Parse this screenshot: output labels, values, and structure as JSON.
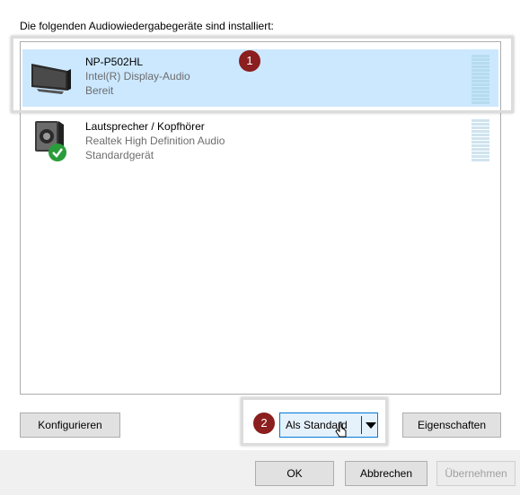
{
  "intro_text": "Die folgenden Audiowiedergabegeräte sind installiert:",
  "devices": [
    {
      "name": "NP-P502HL",
      "driver": "Intel(R) Display-Audio",
      "status": "Bereit",
      "icon": "monitor-icon",
      "selected": true
    },
    {
      "name": "Lautsprecher / Kopfhörer",
      "driver": "Realtek High Definition Audio",
      "status": "Standardgerät",
      "icon": "speaker-icon",
      "default": true
    }
  ],
  "badges": [
    "1",
    "2"
  ],
  "buttons": {
    "configure": "Konfigurieren",
    "set_default": "Als Standard",
    "properties": "Eigenschaften",
    "ok": "OK",
    "cancel": "Abbrechen",
    "apply": "Übernehmen"
  },
  "colors": {
    "selection": "#cce8ff",
    "badge": "#8b1e1e",
    "focus_border": "#0078d7",
    "check_green": "#2a9d3a"
  }
}
